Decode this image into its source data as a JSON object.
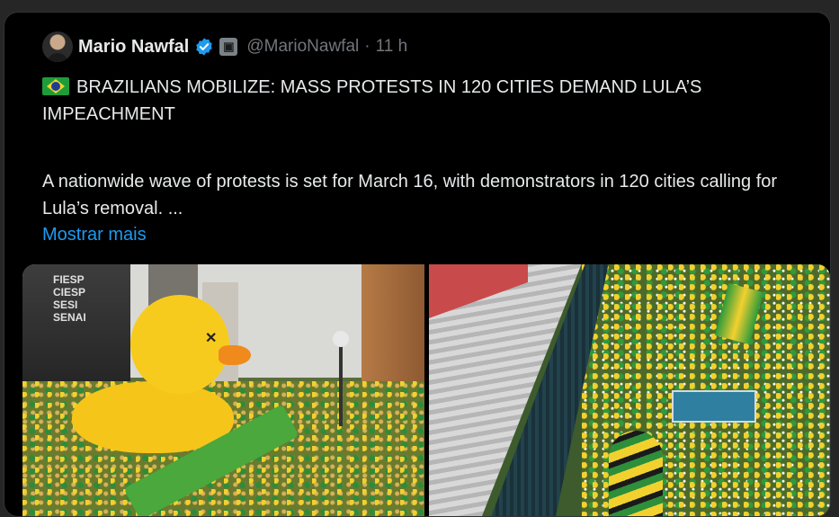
{
  "tweet": {
    "author_name": "Mario Nawfal",
    "handle": "@MarioNawfal",
    "separator": "·",
    "time": "11 h",
    "headline": "BRAZILIANS MOBILIZE: MASS PROTESTS IN 120 CITIES DEMAND LULA’S IMPEACHMENT",
    "body": "A nationwide wave of protests is set for March 16, with demonstrators in 120 cities calling for Lula’s removal. ...",
    "show_more": "Mostrar mais"
  },
  "media": {
    "photo1_sign": "FIESP CIESP SESI SENAI",
    "photo1_sign_lines": [
      "FIESP",
      "CIESP",
      "SESI",
      "SENAI"
    ]
  },
  "colors": {
    "background": "#000000",
    "text": "#e7e9ea",
    "muted": "#71767b",
    "link": "#1d9bf0",
    "verified": "#1d9bf0"
  },
  "icons": {
    "verified": "verified-badge-icon",
    "affiliate": "affiliate-badge-icon",
    "flag": "brazil-flag-emoji"
  }
}
